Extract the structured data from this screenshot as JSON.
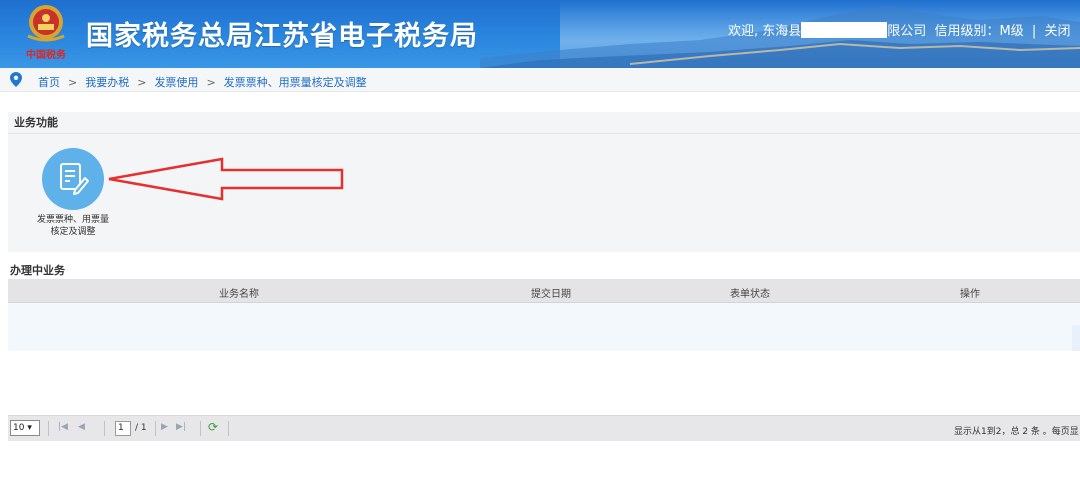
{
  "header": {
    "title": "国家税务总局江苏省电子税务局",
    "welcome_prefix": "欢迎, 东海县",
    "welcome_suffix": "限公司",
    "credit_level": "信用级别：M级",
    "divider": "|",
    "close_label": "关闭"
  },
  "logo": {
    "caption": "中国税务"
  },
  "breadcrumb": {
    "items": [
      "首页",
      "我要办税",
      "发票使用",
      "发票票种、用票量核定及调整"
    ],
    "separator": ">"
  },
  "business_functions": {
    "title": "业务功能",
    "items": [
      {
        "label_line1": "发票票种、用票量",
        "label_line2": "核定及调整",
        "icon": "edit-document-icon"
      }
    ]
  },
  "in_progress": {
    "title": "办理中业务",
    "columns": [
      "业务名称",
      "提交日期",
      "表单状态",
      "操作"
    ],
    "rows": []
  },
  "pager": {
    "page_size": "10 ▾",
    "current_page": "1",
    "total_pages": "/ 1",
    "summary": "显示从1到2，总 2 条 。每页显"
  },
  "colors": {
    "header_blue": "#2a86de",
    "icon_circle": "#5eb1e9",
    "annotation_arrow": "#e53030",
    "link": "#1e6cc8"
  }
}
